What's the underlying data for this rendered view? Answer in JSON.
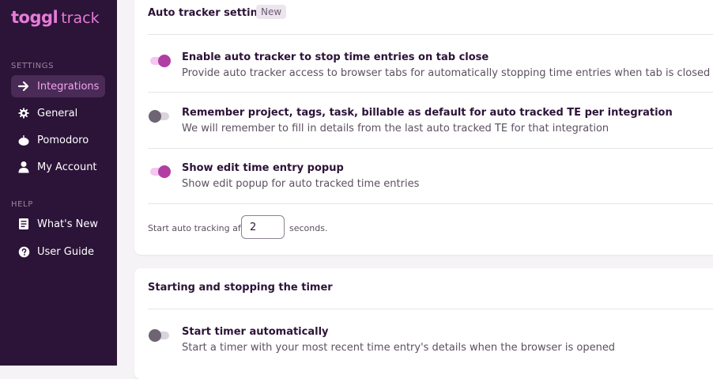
{
  "brand": {
    "logo_main": "toggl",
    "logo_sub": "track"
  },
  "sidebar": {
    "settings_heading": "SETTINGS",
    "help_heading": "HELP",
    "settings_items": [
      {
        "label": "Integrations",
        "icon": "arrow-right-icon",
        "active": true
      },
      {
        "label": "General",
        "icon": "gear-icon"
      },
      {
        "label": "Pomodoro",
        "icon": "tomato-icon"
      },
      {
        "label": "My Account",
        "icon": "user-icon"
      }
    ],
    "help_items": [
      {
        "label": "What's New",
        "icon": "document-icon"
      },
      {
        "label": "User Guide",
        "icon": "help-circle-icon"
      }
    ]
  },
  "auto_tracker": {
    "title": "Auto tracker settings",
    "badge": "New",
    "settings": [
      {
        "title": "Enable auto tracker to stop time entries on tab close",
        "description": "Provide auto tracker access to browser tabs for automatically stopping time entries when tab is closed",
        "enabled": true
      },
      {
        "title": "Remember project, tags, task, billable as default for auto tracked TE per integration",
        "description": "We will remember to fill in details from the last auto tracked TE for that integration",
        "enabled": false
      },
      {
        "title": "Show edit time entry popup",
        "description": "Show edit popup for auto tracked time entries",
        "enabled": true
      }
    ],
    "delay_prefix": "Start auto tracking after",
    "delay_value": "2",
    "delay_suffix": "seconds."
  },
  "timer": {
    "title": "Starting and stopping the timer",
    "settings": [
      {
        "title": "Start timer automatically",
        "description": "Start a timer with your most recent time entry's details when the browser is opened",
        "enabled": false
      }
    ]
  },
  "colors": {
    "sidebar_bg": "#2c1338",
    "accent": "#e57cd8",
    "toggle_on": "#b13fa3",
    "toggle_off": "#6f6572"
  }
}
